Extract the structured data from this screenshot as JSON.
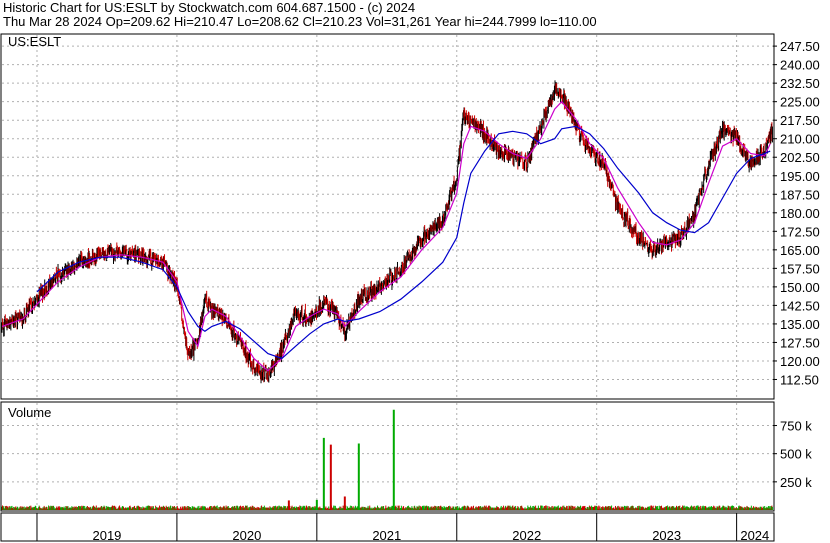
{
  "header": {
    "line1": "Historic Chart for US:ESLT by Stockwatch.com 604.687.1500 - (c) 2024",
    "line2": "Thu Mar 28 2024   Op=209.62   Hi=210.47   Lo=208.62   Cl=210.23   Vol=31,261   Year hi=244.7999   lo=110.00"
  },
  "colors": {
    "up_bar": "#000000",
    "down_bar": "#cc0000",
    "ma_fast": "#cc00cc",
    "ma_slow": "#0000cc",
    "vol_up": "#00aa00",
    "vol_down": "#cc0000",
    "grid": "#b0b0b0"
  },
  "chart_data": [
    {
      "type": "line",
      "title": "US:ESLT",
      "ylim": [
        105,
        252
      ],
      "y_ticks": [
        "247.50",
        "240.00",
        "232.50",
        "225.00",
        "217.50",
        "210.00",
        "202.50",
        "195.00",
        "187.50",
        "180.00",
        "172.50",
        "165.00",
        "157.50",
        "150.00",
        "142.50",
        "135.00",
        "127.50",
        "120.00",
        "112.50"
      ],
      "x_ticks": [
        "2019",
        "2020",
        "2021",
        "2022",
        "2023",
        "2024"
      ],
      "grid": true,
      "x": [
        2018.75,
        2018.9,
        2019.0,
        2019.15,
        2019.3,
        2019.45,
        2019.6,
        2019.75,
        2019.9,
        2020.0,
        2020.08,
        2020.15,
        2020.2,
        2020.25,
        2020.35,
        2020.45,
        2020.55,
        2020.65,
        2020.75,
        2020.85,
        2020.95,
        2021.05,
        2021.15,
        2021.2,
        2021.3,
        2021.45,
        2021.6,
        2021.75,
        2021.9,
        2022.0,
        2022.05,
        2022.1,
        2022.2,
        2022.3,
        2022.4,
        2022.5,
        2022.6,
        2022.7,
        2022.75,
        2022.85,
        2022.95,
        2023.05,
        2023.15,
        2023.3,
        2023.4,
        2023.5,
        2023.6,
        2023.7,
        2023.8,
        2023.9,
        2024.0,
        2024.1,
        2024.2,
        2024.24
      ],
      "series": [
        {
          "values": [
            134,
            138,
            145,
            155,
            160,
            163,
            164,
            162,
            160,
            150,
            122,
            128,
            145,
            141,
            137,
            127,
            118,
            114,
            125,
            140,
            137,
            144,
            138,
            131,
            145,
            150,
            157,
            170,
            177,
            195,
            220,
            217,
            212,
            205,
            203,
            200,
            215,
            230,
            228,
            215,
            205,
            200,
            182,
            170,
            165,
            168,
            170,
            180,
            200,
            213,
            210,
            200,
            205,
            212,
            200,
            205,
            210,
            206,
            210
          ]
        },
        {
          "name": "",
          "values": []
        },
        {
          "name": "",
          "values": []
        }
      ],
      "ma_fast": [
        134,
        137,
        143,
        152,
        158,
        162,
        163,
        162,
        160,
        152,
        132,
        126,
        138,
        141,
        138,
        130,
        121,
        116,
        121,
        134,
        138,
        141,
        139,
        134,
        140,
        148,
        154,
        165,
        174,
        188,
        208,
        215,
        213,
        208,
        204,
        202,
        210,
        222,
        225,
        218,
        208,
        202,
        190,
        176,
        168,
        167,
        169,
        176,
        192,
        207,
        210,
        204,
        203,
        208,
        204,
        204,
        208,
        207,
        209
      ],
      "ma_slow": [
        null,
        null,
        148,
        156,
        160,
        162,
        162,
        160,
        157,
        150,
        140,
        134,
        132,
        134,
        136,
        133,
        128,
        123,
        121,
        126,
        131,
        135,
        137,
        136,
        137,
        140,
        145,
        152,
        160,
        170,
        184,
        196,
        205,
        212,
        213,
        212,
        208,
        210,
        214,
        215,
        212,
        206,
        198,
        188,
        180,
        176,
        173,
        172,
        176,
        186,
        196,
        202,
        204,
        205,
        204,
        203,
        204,
        206,
        207
      ]
    },
    {
      "type": "bar",
      "title": "Volume",
      "ylim": [
        0,
        950
      ],
      "y_ticks": [
        "750 k",
        "500 k",
        "250 k"
      ],
      "spikes": [
        {
          "x": 2021.05,
          "value": 640,
          "direction": "up"
        },
        {
          "x": 2021.1,
          "value": 580,
          "direction": "down"
        },
        {
          "x": 2021.3,
          "value": 590,
          "direction": "up"
        },
        {
          "x": 2021.55,
          "value": 890,
          "direction": "up"
        },
        {
          "x": 2021.0,
          "value": 90,
          "direction": "up"
        },
        {
          "x": 2020.8,
          "value": 85,
          "direction": "down"
        },
        {
          "x": 2021.2,
          "value": 120,
          "direction": "down"
        }
      ],
      "baseline_volume_k": 25
    }
  ]
}
